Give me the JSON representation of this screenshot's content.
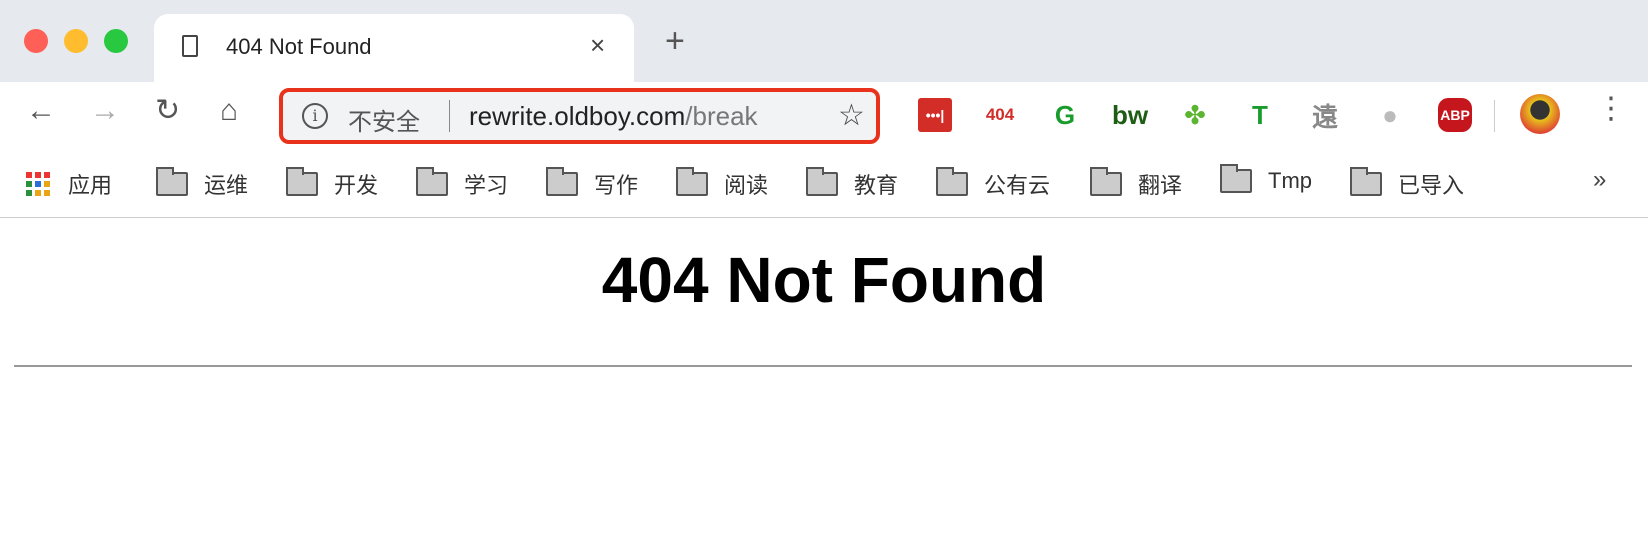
{
  "window": {
    "traffic_lights": [
      "#fe5f57",
      "#febc2e",
      "#28c840"
    ]
  },
  "tab": {
    "title": "404 Not Found",
    "close": "×",
    "new_tab": "+"
  },
  "toolbar": {
    "back": "←",
    "forward": "→",
    "reload": "↻",
    "home": "⌂",
    "security_label": "不安全",
    "url_host": "rewrite.oldboy.com",
    "url_path": "/break",
    "highlight_color": "#e8321c",
    "menu": "⋮"
  },
  "extensions": [
    {
      "name": "lastpass",
      "label": "•••|",
      "color": "#d32d27"
    },
    {
      "name": "404",
      "label": "404",
      "color": "#d32d27"
    },
    {
      "name": "grammarly-g",
      "label": "G",
      "color": "#1a9c2c"
    },
    {
      "name": "bw",
      "label": "bw",
      "color": "#1e5e14"
    },
    {
      "name": "clover",
      "label": "✤",
      "color": "#5cb531"
    },
    {
      "name": "t-shield",
      "label": "T",
      "color": "#1a9c2c"
    },
    {
      "name": "calligraphy",
      "label": "遠",
      "color": "#888"
    },
    {
      "name": "globe",
      "label": "●",
      "color": "#bbb"
    },
    {
      "name": "adblock-plus",
      "label": "ABP",
      "color": "#c5161d"
    }
  ],
  "bookmarks": {
    "apps": "应用",
    "folders": [
      "运维",
      "开发",
      "学习",
      "写作",
      "阅读",
      "教育",
      "公有云",
      "翻译",
      "Tmp",
      "已导入"
    ],
    "more": "»"
  },
  "page": {
    "heading": "404 Not Found"
  }
}
